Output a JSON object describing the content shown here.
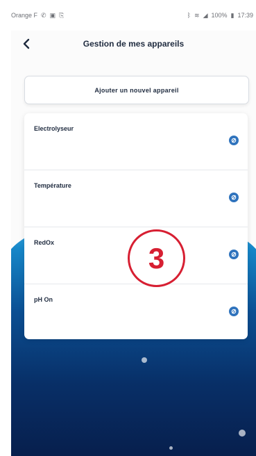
{
  "status_bar": {
    "carrier": "Orange F",
    "battery": "100%",
    "time": "17:39",
    "icons": [
      "phone-icon",
      "photo-icon",
      "cast-icon",
      "bluetooth-icon",
      "wifi-icon",
      "signal-icon",
      "battery-icon"
    ]
  },
  "header": {
    "title": "Gestion de mes appareils",
    "back_icon": "chevron-left-icon"
  },
  "add_button": {
    "label": "Ajouter un nouvel appareil"
  },
  "devices": [
    {
      "label": "Electrolyseur",
      "icon": "settings-icon"
    },
    {
      "label": "Température",
      "icon": "settings-icon"
    },
    {
      "label": "RedOx",
      "icon": "settings-icon"
    },
    {
      "label": "pH On",
      "icon": "settings-icon"
    }
  ],
  "annotation": {
    "step_number": "3"
  },
  "colors": {
    "accent_blue": "#2f73bd",
    "dark_text": "#1f2b3f",
    "annotation_red": "#d71f32",
    "wave_top": "#4ab8e7",
    "wave_bottom": "#071f4d"
  }
}
